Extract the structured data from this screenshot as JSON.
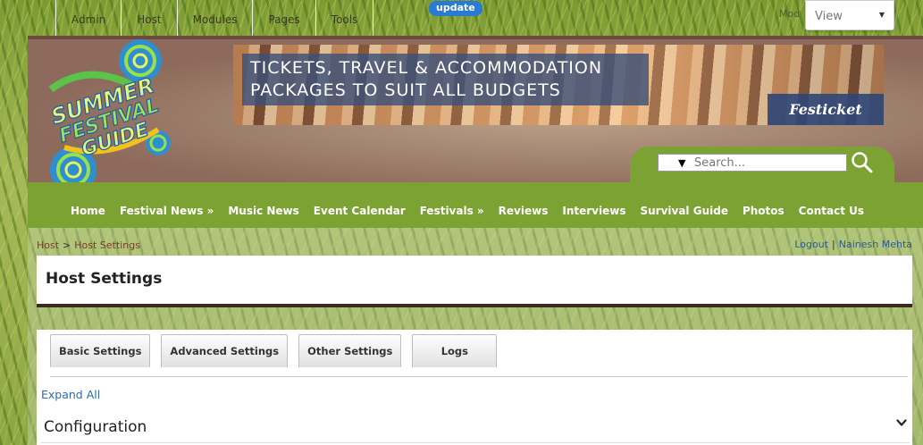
{
  "controlbar": {
    "menu": [
      "Admin",
      "Host",
      "Modules",
      "Pages",
      "Tools"
    ],
    "update_badge": "update",
    "mode_label": "Mod",
    "mode_value": "View"
  },
  "header": {
    "logo": {
      "line1": "SUMMER",
      "line2": "FESTIVAL",
      "line3": "GUIDE"
    },
    "banner": {
      "line1": "TICKETS, TRAVEL & ACCOMMODATION",
      "line2": "PACKAGES TO SUIT ALL BUDGETS",
      "brand": "Festicket"
    },
    "search": {
      "placeholder": "Search...",
      "icon": "search-icon"
    }
  },
  "nav": {
    "items": [
      "Home",
      "Festival News »",
      "Music News",
      "Event Calendar",
      "Festivals »",
      "Reviews",
      "Interviews",
      "Survival Guide",
      "Photos",
      "Contact Us"
    ]
  },
  "breadcrumb": {
    "items": [
      "Host",
      "Host Settings"
    ],
    "separator": ">"
  },
  "user": {
    "logout": "Logout",
    "separator": "|",
    "name": "Nainesh Mehta"
  },
  "page": {
    "title": "Host Settings"
  },
  "settings": {
    "tabs": [
      "Basic Settings",
      "Advanced Settings",
      "Other Settings",
      "Logs"
    ],
    "expand_all": "Expand All",
    "section": "Configuration"
  },
  "colors": {
    "nav_green": "#7ba233",
    "title_rule": "#3b2a20",
    "link_blue": "#2a6ab1"
  }
}
